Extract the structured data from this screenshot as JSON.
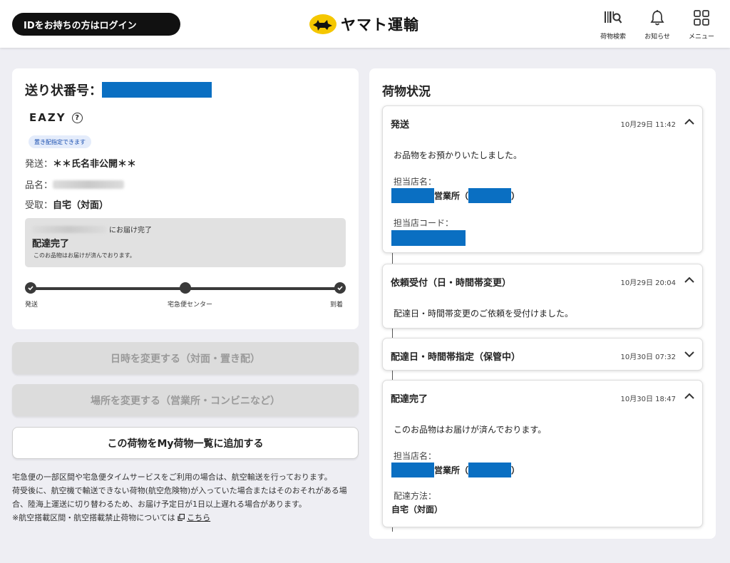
{
  "header": {
    "login_label": "IDをお持ちの方はログイン",
    "logo_text": "ヤマト運輸",
    "nav": [
      {
        "label": "荷物検索",
        "icon": "barcode-search-icon"
      },
      {
        "label": "お知らせ",
        "icon": "bell-icon"
      },
      {
        "label": "メニュー",
        "icon": "grid-menu-icon"
      }
    ]
  },
  "shipment": {
    "tracking_label": "送り状番号：",
    "service_name": "EAZY",
    "help_glyph": "?",
    "badge": "置き配指定できます",
    "sender_label": "発送：",
    "sender_value": "＊＊氏名非公開＊＊",
    "item_label": "品名：",
    "receive_label": "受取：",
    "receive_value": "自宅（対面）",
    "status": {
      "delivered_suffix": "にお届け完了",
      "title": "配達完了",
      "note": "このお品物はお届けが済んでおります。"
    },
    "progress_steps": [
      "発送",
      "宅急便センター",
      "到着"
    ]
  },
  "actions": {
    "change_datetime": "日時を変更する（対面・置き配）",
    "change_place": "場所を変更する（営業所・コンビニなど）",
    "add_to_list": "この荷物をMy荷物一覧に追加する"
  },
  "footnote": {
    "line1": "宅急便の一部区間や宅急便タイムサービスをご利用の場合は、航空輸送を行っております。",
    "line2": "荷受後に、航空機で輸送できない荷物(航空危険物)が入っていた場合またはそのおそれがある場合、陸海上運送に切り替わるため、お届け予定日が1日以上遅れる場合があります。",
    "line3": "※航空搭載区間・航空搭載禁止荷物については",
    "link": "こちら"
  },
  "tracking": {
    "title": "荷物状況",
    "events": [
      {
        "title": "発送",
        "time": "10月29日 11:42",
        "message": "お品物をお預かりいたしました。",
        "store_label": "担当店名：",
        "store_suffix": "営業所（",
        "store_close": "）",
        "code_label": "担当店コード："
      },
      {
        "title": "依頼受付（日・時間帯変更）",
        "time": "10月29日 20:04",
        "message": "配達日・時間帯変更のご依頼を受付けました。"
      },
      {
        "title": "配達日・時間帯指定（保管中）",
        "time": "10月30日 07:32"
      },
      {
        "title": "配達完了",
        "time": "10月30日 18:47",
        "message": "このお品物はお届けが済んでおります。",
        "store_label": "担当店名：",
        "store_suffix": "営業所（",
        "store_close": "）",
        "method_label": "配達方法：",
        "method_value": "自宅（対面）"
      }
    ]
  },
  "colors": {
    "redaction": "#0a6fc2",
    "brand_yellow": "#f5c700"
  }
}
